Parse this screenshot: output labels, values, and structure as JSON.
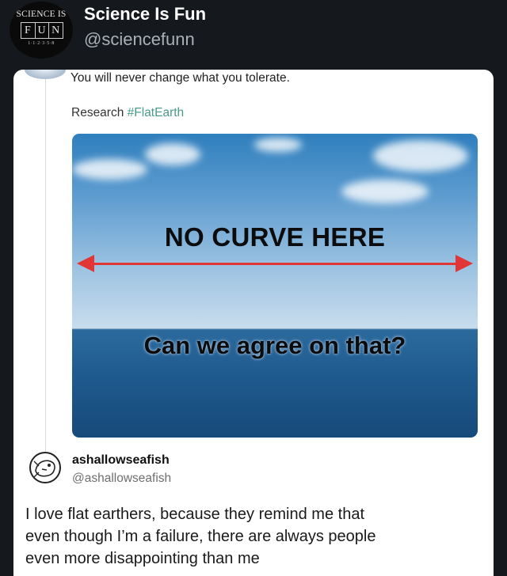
{
  "account": {
    "display_name": "Science Is Fun",
    "handle": "@sciencefunn",
    "avatar": {
      "top_text": "SCIENCE IS",
      "letters": [
        "F",
        "U",
        "N"
      ],
      "sequence": "1·1·2·3·5·8"
    }
  },
  "embedded_post": {
    "quote": "You will never change what you tolerate.",
    "research_label": "Research",
    "hashtag": "#FlatEarth",
    "image": {
      "headline": "NO CURVE HERE",
      "subline": "Can we agree on that?"
    }
  },
  "reply": {
    "name": "ashallowseafish",
    "handle": "@ashallowseafish",
    "lines": [
      "I love flat earthers, because they remind me that",
      "even though I’m a failure, there are always people",
      "even more disappointing than me"
    ]
  },
  "colors": {
    "background": "#15181c",
    "hashtag": "#4a9a8a",
    "arrow": "#e23636"
  }
}
